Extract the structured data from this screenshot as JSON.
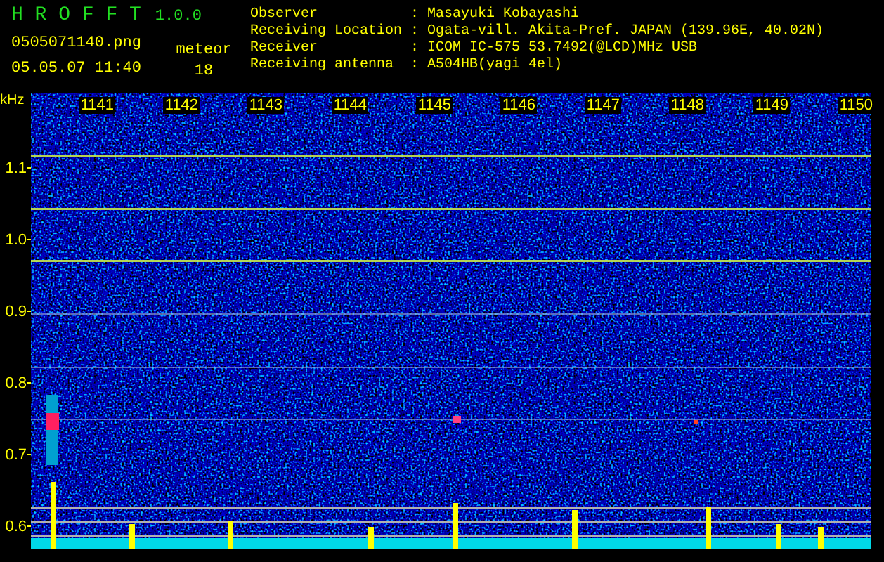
{
  "app": {
    "title": "H R O F F T",
    "version": "1.0.0",
    "file": "0505071140.png",
    "datetime": "05.05.07 11:40",
    "count_label": "meteor",
    "count": "18"
  },
  "info": [
    {
      "label": "Observer",
      "separator": ":",
      "value": "Masayuki Kobayashi"
    },
    {
      "label": "Receiving Location",
      "separator": ":",
      "value": "Ogata-vill. Akita-Pref. JAPAN (139.96E, 40.02N)"
    },
    {
      "label": "Receiver",
      "separator": ":",
      "value": "ICOM IC-575 53.7492(@LCD)MHz USB"
    },
    {
      "label": "Receiving antenna",
      "separator": ":",
      "value": "A504HB(yagi 4el)"
    }
  ],
  "spectrogram": {
    "unit": "kHz",
    "y_labels": [
      "1.1",
      "1.0",
      "0.9",
      "0.8",
      "0.7",
      "0.6"
    ],
    "time_labels": [
      "1141",
      "1142",
      "1143",
      "1144",
      "1145",
      "1146",
      "1147",
      "1148",
      "1149",
      "1150"
    ]
  }
}
